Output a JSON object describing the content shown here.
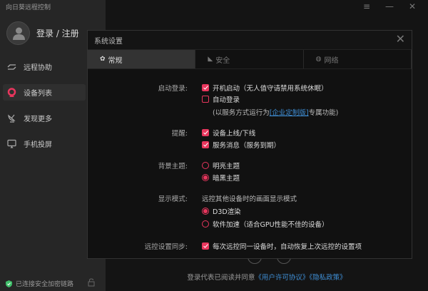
{
  "app_title": "向日葵远程控制",
  "login_label": "登录 / 注册",
  "nav": [
    {
      "label": "远程协助",
      "icon": "remote-assist-icon"
    },
    {
      "label": "设备列表",
      "icon": "device-list-icon",
      "active": true
    },
    {
      "label": "发现更多",
      "icon": "satellite-icon"
    },
    {
      "label": "手机投屏",
      "icon": "screen-cast-icon"
    }
  ],
  "status_text": "已连接安全加密链路",
  "footer": {
    "prefix": "登录代表已阅读并同意",
    "eula": "《用户许可协议》",
    "privacy": "《隐私政策》"
  },
  "accent_color": "#e8365d",
  "dialog": {
    "title": "系统设置",
    "tabs": [
      {
        "label": "常规",
        "icon": "gear-icon"
      },
      {
        "label": "安全",
        "icon": "shield-icon"
      },
      {
        "label": "网络",
        "icon": "globe-icon"
      }
    ],
    "startup": {
      "label": "启动登录:",
      "boot": "开机启动（无人值守请禁用系统休眠）",
      "boot_checked": true,
      "auto_login": "自动登录",
      "auto_login_checked": false,
      "note_prefix": "(以服务方式运行为",
      "note_link": "[企业定制版]",
      "note_suffix": "专属功能)"
    },
    "remind": {
      "label": "提醒:",
      "online": "设备上线/下线",
      "online_checked": true,
      "service": "服务消息（服务到期）",
      "service_checked": true
    },
    "theme": {
      "label": "背景主题:",
      "light": "明亮主题",
      "dark": "暗黑主题",
      "selected": "dark"
    },
    "display": {
      "label": "显示模式:",
      "desc": "远控其他设备时的画面显示模式",
      "d3d": "D3D渲染",
      "software": "软件加速（适合GPU性能不佳的设备）",
      "selected": "d3d"
    },
    "sync": {
      "label": "远控设置同步:",
      "text": "每次远控同一设备时，自动恢复上次远控的设置项",
      "checked": true
    }
  }
}
